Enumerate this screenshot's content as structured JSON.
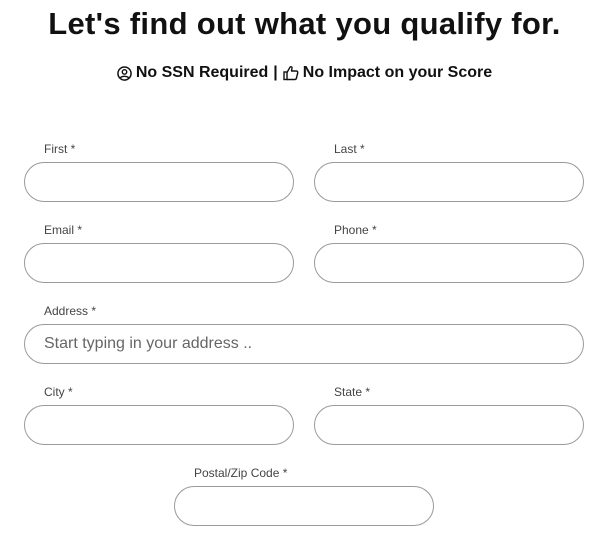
{
  "header": {
    "title": "Let's find out what you qualify for.",
    "badge_ssn": "No SSN Required",
    "separator": "|",
    "badge_score": "No Impact on your Score"
  },
  "form": {
    "first": {
      "label": "First *",
      "value": ""
    },
    "last": {
      "label": "Last *",
      "value": ""
    },
    "email": {
      "label": "Email *",
      "value": ""
    },
    "phone": {
      "label": "Phone *",
      "value": ""
    },
    "address": {
      "label": "Address *",
      "value": "",
      "placeholder": "Start typing in your address .."
    },
    "city": {
      "label": "City *",
      "value": ""
    },
    "state": {
      "label": "State *",
      "value": ""
    },
    "zip": {
      "label": "Postal/Zip Code *",
      "value": ""
    }
  },
  "icons": {
    "ssn": "user-circle-icon",
    "score": "thumbs-up-icon"
  }
}
